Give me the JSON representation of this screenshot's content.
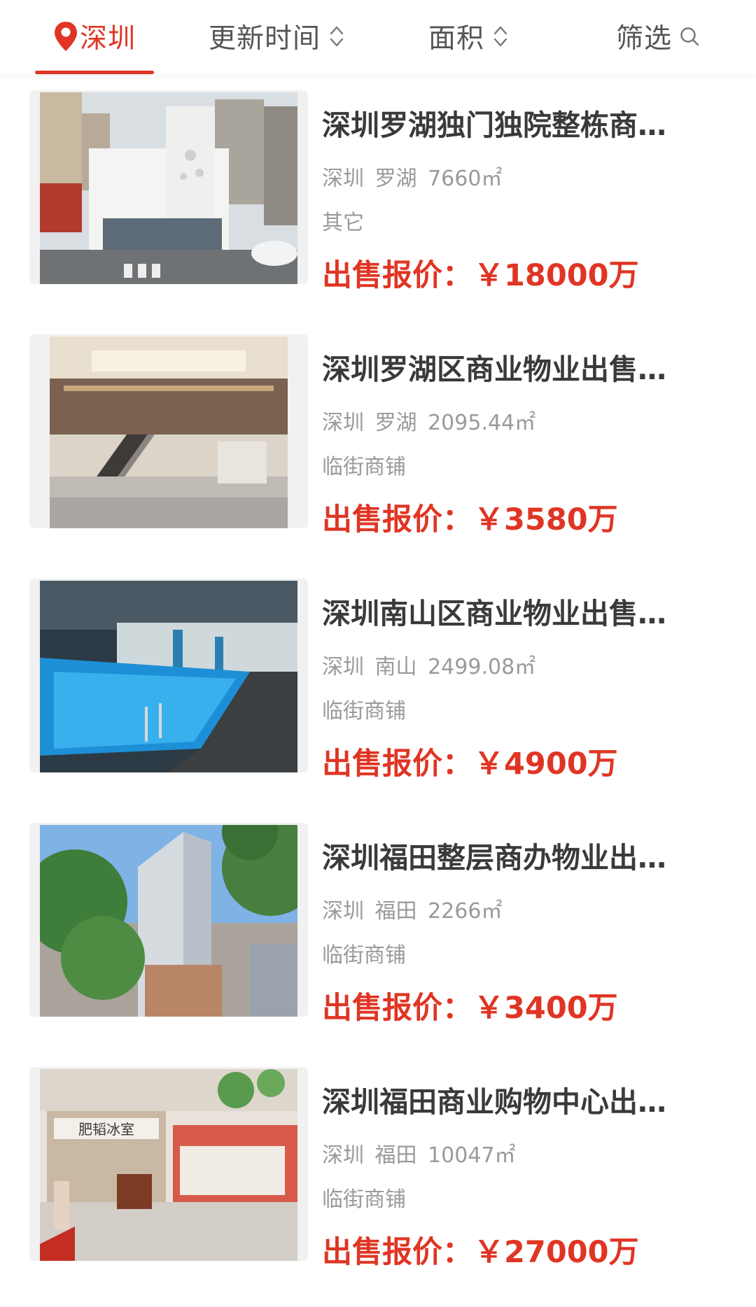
{
  "filter_bar": {
    "city": "深圳",
    "update_time": "更新时间",
    "area": "面积",
    "filter": "筛选"
  },
  "colors": {
    "accent": "#e03524",
    "title_text": "#3a3a3a",
    "meta_text": "#9a9a9a",
    "tab_text": "#555555"
  },
  "icons": [
    "location-pin-icon",
    "sort-updown-icon",
    "search-icon"
  ],
  "listings": [
    {
      "title": "深圳罗湖独门独院整栋商…",
      "city": "深圳",
      "district": "罗湖",
      "area": "7660㎡",
      "type": "其它",
      "price_label": "出售报价：",
      "price": "￥18000万",
      "photo": "white-building-street-photo"
    },
    {
      "title": "深圳罗湖区商业物业出售…",
      "city": "深圳",
      "district": "罗湖",
      "area": "2095.44㎡",
      "type": "临街商铺",
      "price_label": "出售报价：",
      "price": "￥3580万",
      "photo": "atrium-escalator-photo"
    },
    {
      "title": "深圳南山区商业物业出售…",
      "city": "深圳",
      "district": "南山",
      "area": "2499.08㎡",
      "type": "临街商铺",
      "price_label": "出售报价：",
      "price": "￥4900万",
      "photo": "indoor-pool-photo"
    },
    {
      "title": "深圳福田整层商办物业出…",
      "city": "深圳",
      "district": "福田",
      "area": "2266㎡",
      "type": "临街商铺",
      "price_label": "出售报价：",
      "price": "￥3400万",
      "photo": "highrise-tower-photo"
    },
    {
      "title": "深圳福田商业购物中心出…",
      "city": "深圳",
      "district": "福田",
      "area": "10047㎡",
      "type": "临街商铺",
      "price_label": "出售报价：",
      "price": "￥27000万",
      "photo": "shopping-mall-photo",
      "photo_sign": "肥韬冰室"
    }
  ]
}
